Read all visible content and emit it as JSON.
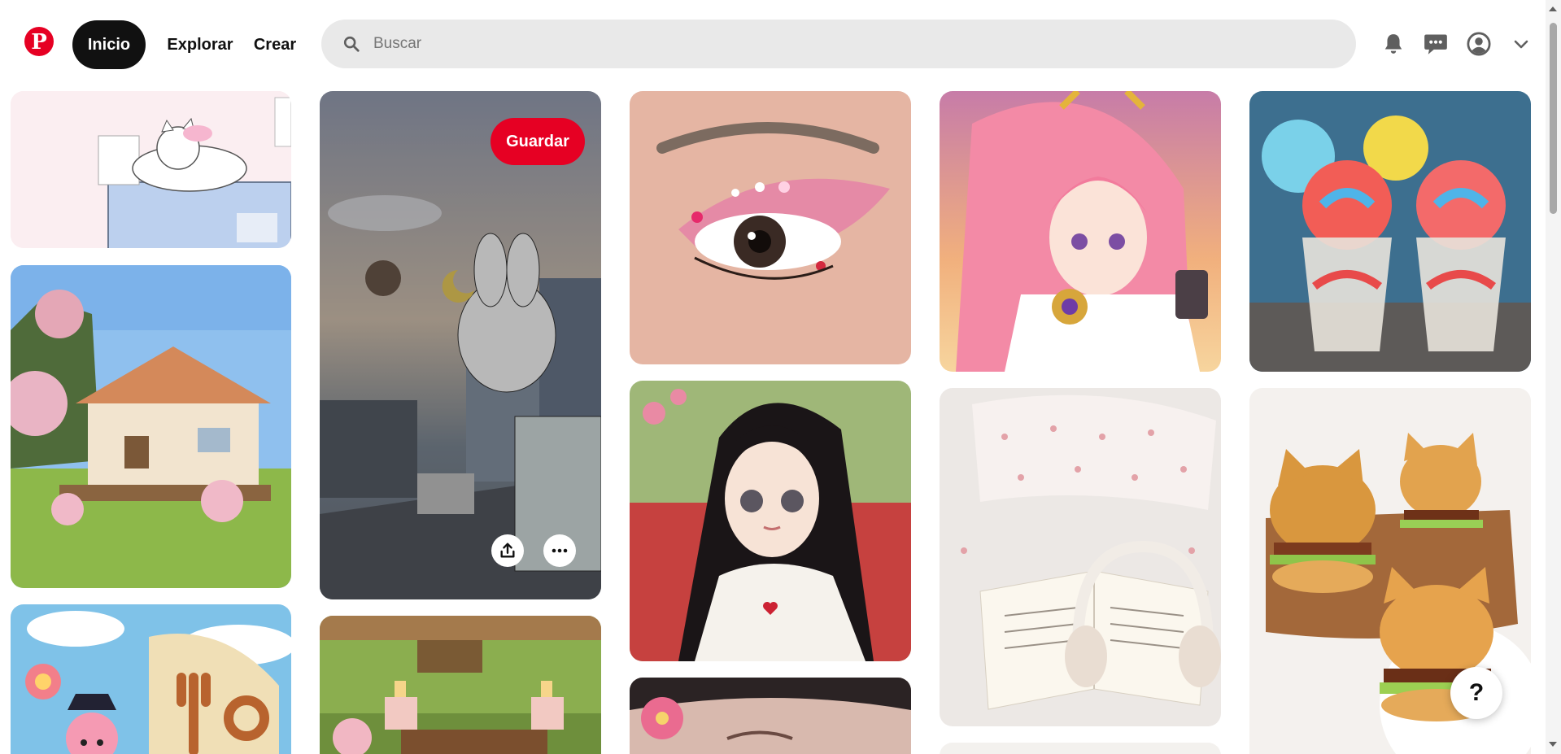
{
  "header": {
    "logo_letter": "P",
    "nav": {
      "home": "Inicio",
      "explore": "Explorar",
      "create": "Crear"
    },
    "search": {
      "placeholder": "Buscar",
      "value": ""
    },
    "icons": [
      "bell-icon",
      "messages-icon",
      "profile-icon",
      "chevron-down-icon"
    ]
  },
  "pin_actions": {
    "save_label": "Guardar"
  },
  "help": {
    "label": "?"
  },
  "pins": [
    {
      "name": "pin-sleeping-cat-computer",
      "col": 0
    },
    {
      "name": "pin-minecraft-house",
      "col": 0
    },
    {
      "name": "pin-kirby-sailing",
      "col": 0
    },
    {
      "name": "pin-city-doodle-street",
      "col": 1
    },
    {
      "name": "pin-minecraft-garden",
      "col": 1
    },
    {
      "name": "pin-pink-eye-makeup",
      "col": 2
    },
    {
      "name": "pin-anime-girl-black-hair",
      "col": 2
    },
    {
      "name": "pin-flower-face",
      "col": 2
    },
    {
      "name": "pin-genshin-yae-miko",
      "col": 3
    },
    {
      "name": "pin-book-headphones",
      "col": 3
    },
    {
      "name": "pin-rainbow-ice-cups",
      "col": 4
    },
    {
      "name": "pin-cat-burgers",
      "col": 4
    }
  ],
  "colors": {
    "brand": "#e60023",
    "nav_active_bg": "#111111",
    "search_bg": "#e9e9e9"
  }
}
